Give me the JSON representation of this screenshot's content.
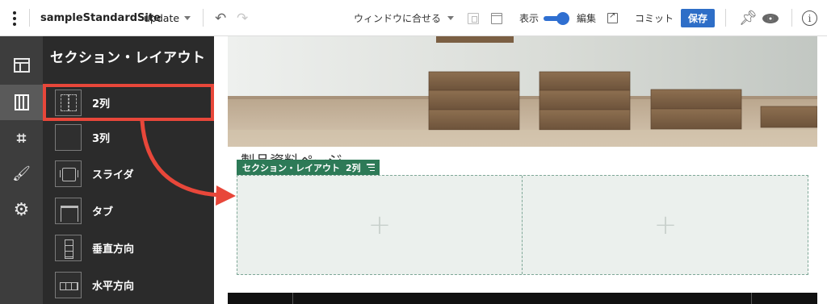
{
  "topbar": {
    "site_name": "sampleStandardSite",
    "branch": "update",
    "fit_window": "ウィンドウに合せる",
    "view_label": "表示",
    "edit_label": "編集",
    "commit_label": "コミット",
    "save_label": "保存"
  },
  "rail": {
    "items": [
      {
        "icon": "layout-icon",
        "active": false
      },
      {
        "icon": "columns-icon",
        "active": true
      },
      {
        "icon": "crop-icon",
        "active": false
      },
      {
        "icon": "brush-icon",
        "active": false
      },
      {
        "icon": "gear-icon",
        "active": false
      }
    ]
  },
  "panel": {
    "title": "セクション・レイアウト",
    "items": [
      {
        "label": "2列",
        "highlighted": true
      },
      {
        "label": "3列"
      },
      {
        "label": "スライダ"
      },
      {
        "label": "タブ"
      },
      {
        "label": "垂直方向"
      },
      {
        "label": "水平方向"
      }
    ]
  },
  "canvas": {
    "page_heading": "製品資料ページ",
    "section_tag": {
      "label": "セクション・レイアウト",
      "columns": "2列"
    }
  },
  "colors": {
    "accent": "#e8473a",
    "save": "#2e6ec7",
    "section_tag": "#2d7a57",
    "section_bg": "#ebf0ed",
    "rail_bg": "#3d3d3d",
    "panel_bg": "#2b2b2b"
  }
}
